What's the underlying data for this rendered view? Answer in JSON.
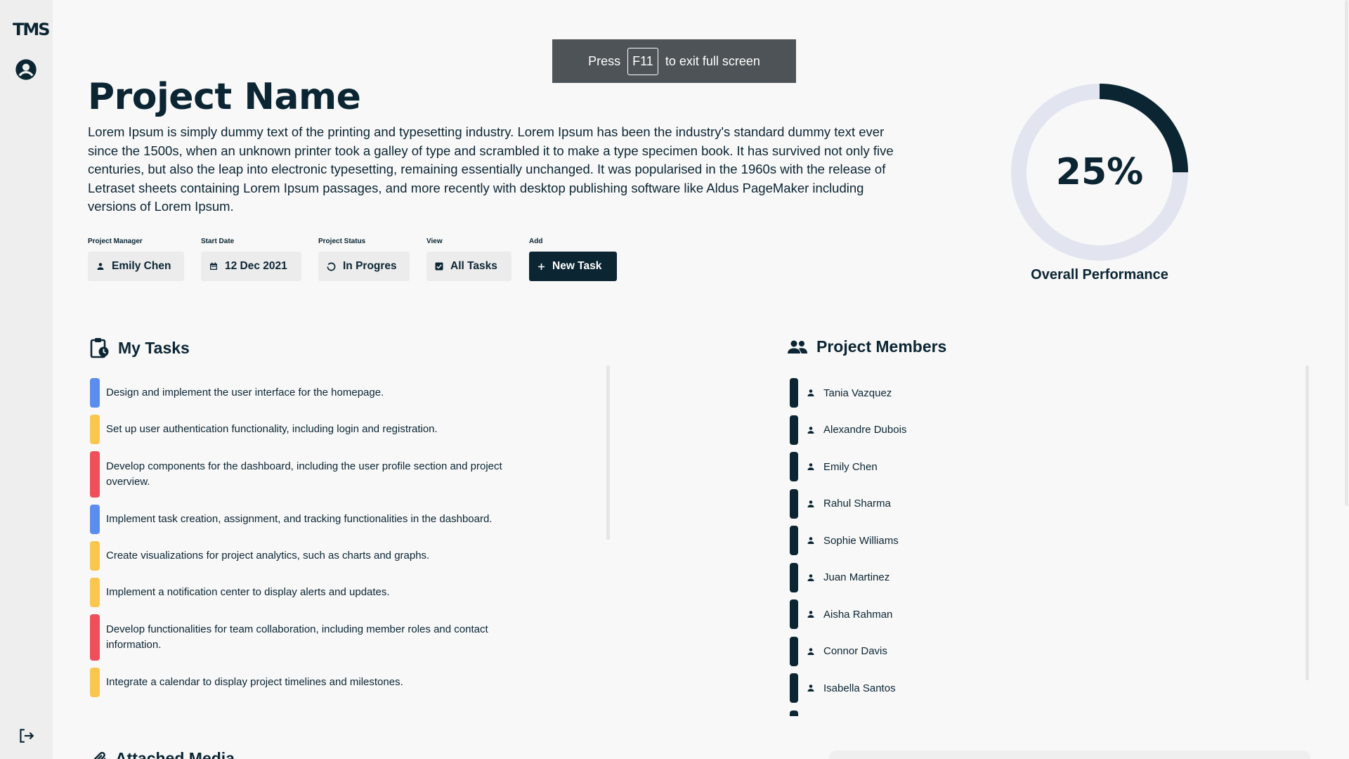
{
  "app": {
    "logo_text": "TMS"
  },
  "fullscreen_notice": {
    "prefix": "Press",
    "key": "F11",
    "suffix": "to exit full screen"
  },
  "project": {
    "title": "Project Name",
    "description": "Lorem Ipsum is simply dummy text of the printing and typesetting industry. Lorem Ipsum has been the industry's standard dummy text ever since the 1500s, when an unknown printer took a galley of type and scrambled it to make a type specimen book. It has survived not only five centuries, but also the leap into electronic typesetting, remaining essentially unchanged. It was popularised in the 1960s with the release of Letraset sheets containing Lorem Ipsum passages, and more recently with desktop publishing software like Aldus PageMaker including versions of Lorem Ipsum."
  },
  "fields": {
    "manager": {
      "label": "Project Manager",
      "value": "Emily Chen",
      "icon": "person-icon"
    },
    "start_date": {
      "label": "Start Date",
      "value": "12 Dec 2021",
      "icon": "calendar-icon"
    },
    "status": {
      "label": "Project Status",
      "value": "In Progres",
      "icon": "progress-icon"
    },
    "view": {
      "label": "View",
      "value": "All Tasks",
      "icon": "checkbox-icon"
    },
    "add": {
      "label": "Add",
      "value": "New Task",
      "icon": "plus-icon"
    }
  },
  "performance": {
    "percent_text": "25%",
    "value": 0.25,
    "label": "Overall Performance"
  },
  "tasks_section": {
    "title": "My Tasks",
    "icon": "clipboard-clock-icon"
  },
  "tasks": [
    {
      "text": "Design and implement the user interface for the homepage.",
      "color": "#5b8def"
    },
    {
      "text": "Set up user authentication functionality, including login and registration.",
      "color": "#f9c74f"
    },
    {
      "text": "Develop components for the dashboard, including the user profile section and project overview.",
      "color": "#ef4f5a"
    },
    {
      "text": "Implement task creation, assignment, and tracking functionalities in the dashboard.",
      "color": "#5b8def"
    },
    {
      "text": "Create visualizations for project analytics, such as charts and graphs.",
      "color": "#f9c74f"
    },
    {
      "text": "Implement a notification center to display alerts and updates.",
      "color": "#f9c74f"
    },
    {
      "text": "Develop functionalities for team collaboration, including member roles and contact information.",
      "color": "#ef4f5a"
    },
    {
      "text": "Integrate a calendar to display project timelines and milestones.",
      "color": "#f9c74f"
    }
  ],
  "members_section": {
    "title": "Project Members",
    "icon": "people-icon"
  },
  "members": [
    "Tania Vazquez",
    "Alexandre Dubois",
    "Emily Chen",
    "Rahul Sharma",
    "Sophie Williams",
    "Juan Martinez",
    "Aisha Rahman",
    "Connor Davis",
    "Isabella Santos"
  ],
  "attached_section": {
    "title": "Attached Media",
    "icon": "paperclip-icon"
  },
  "colors": {
    "primary": "#0b2533",
    "donut_track": "#e2e5f0",
    "blue": "#5b8def",
    "yellow": "#f9c74f",
    "red": "#ef4f5a"
  }
}
